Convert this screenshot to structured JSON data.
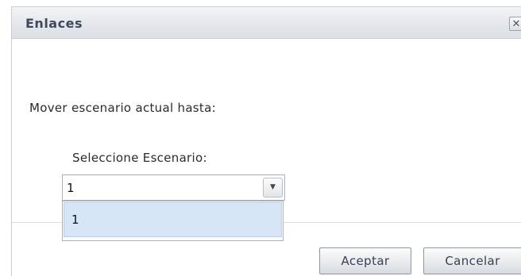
{
  "dialog": {
    "title": "Enlaces",
    "close_glyph": "✕",
    "close_icon": "close-icon"
  },
  "content": {
    "prompt": "Mover escenario actual hasta:",
    "field_label": "Seleccione Escenario:",
    "select": {
      "value": "1",
      "arrow_icon": "chevron-down-icon",
      "arrow_glyph": "▼",
      "options": [
        "1"
      ]
    }
  },
  "buttons": {
    "accept_label": "Aceptar",
    "cancel_label": "Cancelar"
  }
}
